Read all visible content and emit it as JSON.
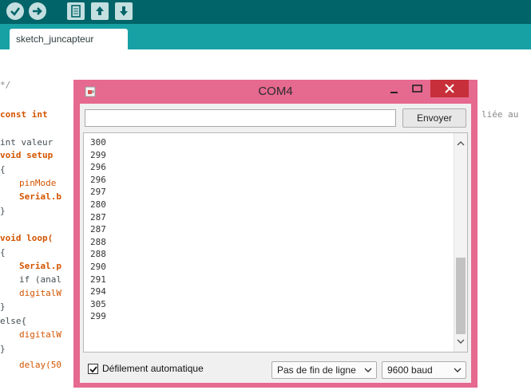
{
  "ide": {
    "tab_label": "sketch_juncapteur",
    "code_lines": [
      "*/",
      "const int",
      "int valeur",
      "void setup",
      "{",
      "pinMode",
      "Serial.b",
      "}",
      "void loop(",
      "{",
      "Serial.p",
      "if (anal",
      "digitalW",
      "}",
      "else{",
      "digitalW",
      "}",
      "delay(50"
    ],
    "right_fragment": "liée au"
  },
  "serial_monitor": {
    "title": "COM4",
    "input_value": "",
    "send_label": "Envoyer",
    "output_lines": [
      "300",
      "299",
      "296",
      "296",
      "297",
      "280",
      "287",
      "287",
      "288",
      "288",
      "290",
      "291",
      "294",
      "305",
      "299"
    ],
    "autoscroll_label": "Défilement automatique",
    "autoscroll_checked": true,
    "line_ending": "Pas de fin de ligne",
    "baud_rate": "9600 baud"
  },
  "colors": {
    "toolbar": "#006468",
    "tabbar": "#17a1a5",
    "window_frame": "#e6698f",
    "close_button": "#c7303a"
  },
  "icons": [
    "verify-icon",
    "upload-icon",
    "new-icon",
    "open-icon",
    "save-icon",
    "java-cup-icon",
    "minimize-icon",
    "maximize-icon",
    "close-icon",
    "checkmark-icon",
    "chevron-down-icon",
    "chevron-up-icon"
  ]
}
